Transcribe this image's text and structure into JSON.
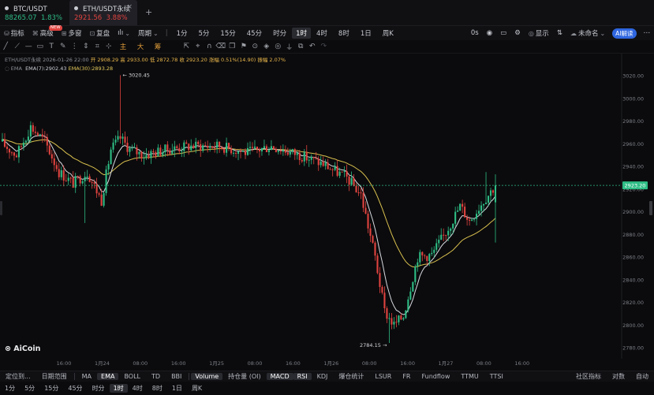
{
  "tabs": [
    {
      "name": "BTC/USDT",
      "price": "88265.07",
      "change": "1.83%",
      "color": "#2ebd85"
    },
    {
      "name": "ETH/USDT永续",
      "price": "2921.56",
      "change": "3.88%",
      "color": "#e0433f"
    }
  ],
  "toolbar": {
    "items": [
      "指标",
      "高级",
      "多窗",
      "复盘",
      "ılı",
      "周期"
    ],
    "new_badge": "NEW",
    "timeframes": [
      "1分",
      "5分",
      "15分",
      "45分",
      "时分",
      "1时",
      "4时",
      "8时",
      "1日",
      "周K"
    ],
    "selected_tf": "1时",
    "right": [
      "0s",
      "显示",
      "未命名",
      "AI解读"
    ]
  },
  "drawtools": {
    "cjk": [
      "主",
      "大",
      "筹"
    ]
  },
  "legend": {
    "symbol": "ETH/USDT永续",
    "time": "2026-01-26 22:00",
    "open": "开 2908.29",
    "high": "高 2933.00",
    "low": "低 2872.78",
    "close": "收 2923.20",
    "change": "涨幅 0.51%(14.90)",
    "amp": "振幅 2.07%",
    "ema_label": "EMA",
    "ema7": "EMA(7):2902.43",
    "ema30": "EMA(30):2893.28"
  },
  "chart_data": {
    "type": "candlestick",
    "yaxis_ticks": [
      3020,
      3000,
      2980,
      2960,
      2940,
      2920,
      2900,
      2880,
      2860,
      2840,
      2820,
      2800,
      2780
    ],
    "ylim": [
      2771,
      3035
    ],
    "xaxis_ticks": [
      "16:00",
      "1月24",
      "08:00",
      "16:00",
      "1月25",
      "08:00",
      "16:00",
      "1月26",
      "08:00",
      "16:00",
      "1月27",
      "08:00",
      "16:00"
    ],
    "last_price": "2923.20",
    "high_label": "3020.45",
    "low_label": "2784.15",
    "colors": {
      "up": "#2ebd85",
      "down": "#e0433f",
      "ema7": "#d7dadf",
      "ema30": "#d8bf4e"
    }
  },
  "brand": "AiCoin",
  "indicators": {
    "left": [
      "定位到...",
      "日期范围",
      "MA",
      "EMA",
      "BOLL",
      "TD",
      "BBI"
    ],
    "selected_main": "EMA",
    "sub": [
      "Volume",
      "持仓量 (OI)",
      "MACD",
      "RSI",
      "KDJ",
      "爆仓统计",
      "LSUR",
      "FR",
      "Fundflow",
      "TTMU",
      "TTSI"
    ],
    "selected_sub": [
      "Volume",
      "MACD",
      "RSI"
    ],
    "right": [
      "社区指标",
      "对数",
      "自动"
    ]
  },
  "bottom_tfs": [
    "1分",
    "5分",
    "15分",
    "45分",
    "时分",
    "1时",
    "4时",
    "8时",
    "1日",
    "周K"
  ],
  "bottom_selected": "1时"
}
